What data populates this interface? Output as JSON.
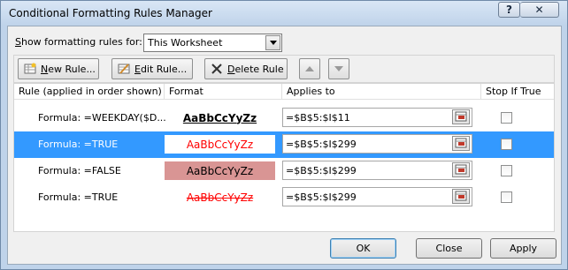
{
  "window": {
    "title": "Conditional Formatting Rules Manager",
    "help_glyph": "?",
    "close_glyph": "✕"
  },
  "show_rules": {
    "label_pre": "S",
    "label_rest": "how formatting rules for:",
    "selected": "This Worksheet"
  },
  "toolbar": {
    "new_rule_u": "N",
    "new_rule_rest": "ew Rule...",
    "edit_rule_u": "E",
    "edit_rule_rest": "dit Rule...",
    "delete_rule_u": "D",
    "delete_rule_rest": "elete Rule",
    "icons": [
      "new-rule-icon",
      "edit-rule-icon",
      "delete-icon",
      "move-up-icon",
      "move-down-icon"
    ]
  },
  "grid": {
    "headers": {
      "rule": "Rule (applied in order shown)",
      "format": "Format",
      "applies_to": "Applies to",
      "stop_if_true": "Stop If True"
    },
    "rows": [
      {
        "rule": "Formula: =WEEKDAY($D...",
        "format_preview": "AaBbCcYyZz",
        "applies_to": "=$B$5:$I$11",
        "stop_if_true": false,
        "selected": false
      },
      {
        "rule": "Formula: =TRUE",
        "format_preview": "AaBbCcYyZz",
        "applies_to": "=$B$5:$I$299",
        "stop_if_true": false,
        "selected": true
      },
      {
        "rule": "Formula: =FALSE",
        "format_preview": "AaBbCcYyZz",
        "applies_to": "=$B$5:$I$299",
        "stop_if_true": false,
        "selected": false
      },
      {
        "rule": "Formula: =TRUE",
        "format_preview": "AaBbCcYyZz",
        "applies_to": "=$B$5:$I$299",
        "stop_if_true": false,
        "selected": false
      }
    ]
  },
  "buttons": {
    "ok": "OK",
    "close": "Close",
    "apply": "Apply"
  },
  "colors": {
    "selection": "#3399ff",
    "red_text": "#ff0000",
    "fill_pink": "#d99594"
  }
}
